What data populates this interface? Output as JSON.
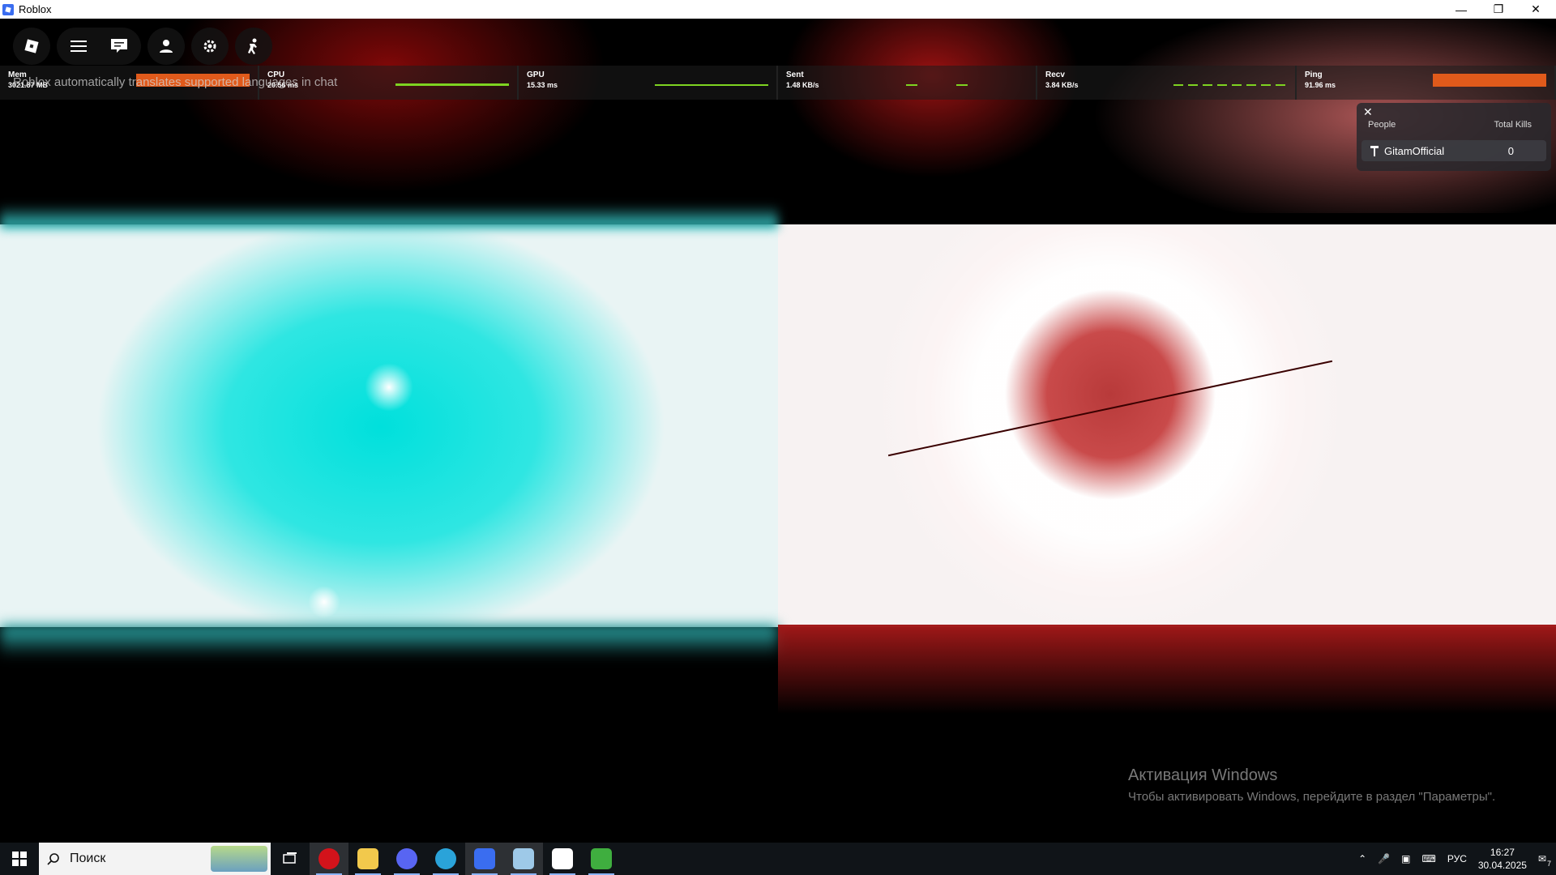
{
  "window": {
    "title": "Roblox"
  },
  "topbar": {
    "icons": [
      "roblox-logo-icon",
      "menu-icon",
      "chat-icon",
      "profile-icon",
      "settings-icon",
      "emote-icon"
    ]
  },
  "chat": {
    "message": "Roblox automatically translates supported languages in chat"
  },
  "stats": [
    {
      "name": "Mem",
      "value": "3021.87 MB",
      "graph_color": "#e05a1b"
    },
    {
      "name": "CPU",
      "value": "20.56 ms",
      "graph_color": "#7ed321"
    },
    {
      "name": "GPU",
      "value": "15.33 ms",
      "graph_color": "#7ed321"
    },
    {
      "name": "Sent",
      "value": "1.48 KB/s",
      "graph_color": "#7ed321"
    },
    {
      "name": "Recv",
      "value": "3.84 KB/s",
      "graph_color": "#7ed321"
    },
    {
      "name": "Ping",
      "value": "91.96 ms",
      "graph_color": "#e05a1b"
    }
  ],
  "leaderboard": {
    "col_people": "People",
    "col_kills": "Total Kills",
    "rows": [
      {
        "name": "GitamOfficial",
        "kills": "0"
      }
    ]
  },
  "activation": {
    "title": "Активация Windows",
    "subtitle": "Чтобы активировать Windows, перейдите в раздел \"Параметры\"."
  },
  "taskbar": {
    "search_placeholder": "Поиск",
    "apps": [
      {
        "name": "task-view",
        "color": "#101418"
      },
      {
        "name": "opera",
        "color": "#d3131b"
      },
      {
        "name": "file-explorer",
        "color": "#f2c94c"
      },
      {
        "name": "discord",
        "color": "#5865f2"
      },
      {
        "name": "telegram",
        "color": "#2aa3d9"
      },
      {
        "name": "roblox",
        "color": "#3a6df0"
      },
      {
        "name": "notepad",
        "color": "#9ec9e8"
      },
      {
        "name": "roblox-studio",
        "color": "#ffffff"
      },
      {
        "name": "minecraft",
        "color": "#3fae3f"
      }
    ],
    "language": "РУС",
    "time": "16:27",
    "date": "30.04.2025",
    "notification_count": "7"
  }
}
